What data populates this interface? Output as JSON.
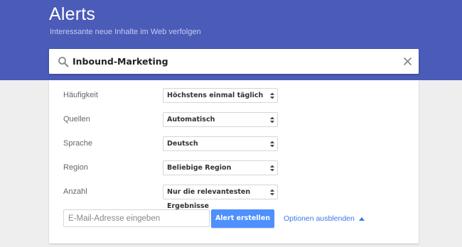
{
  "header": {
    "title": "Alerts",
    "subtitle": "Interessante neue Inhalte im Web verfolgen",
    "background_color": "#4b5bb8"
  },
  "search": {
    "value": "Inbound-Marketing",
    "icon": "search-icon",
    "clear_icon": "close-icon"
  },
  "options": [
    {
      "label": "Häufigkeit",
      "value": "Höchstens einmal täglich"
    },
    {
      "label": "Quellen",
      "value": "Automatisch"
    },
    {
      "label": "Sprache",
      "value": "Deutsch"
    },
    {
      "label": "Region",
      "value": "Beliebige Region"
    },
    {
      "label": "Anzahl",
      "value": "Nur die relevantesten Ergebnisse"
    }
  ],
  "email": {
    "placeholder": "E-Mail-Adresse eingeben"
  },
  "actions": {
    "create_label": "Alert erstellen",
    "create_color": "#4d90fe",
    "options_label": "Optionen ausblenden",
    "options_icon": "caret-up-icon",
    "link_color": "#3b78e7"
  }
}
